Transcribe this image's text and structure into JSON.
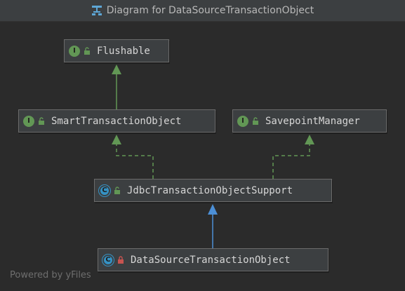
{
  "window": {
    "title": "Diagram for DataSourceTransactionObject",
    "title_icon": "diagram-icon"
  },
  "nodes": {
    "flushable": {
      "label": "Flushable",
      "kind": "I",
      "kind_icon": "interface-icon",
      "visibility_icon": "unlock-icon"
    },
    "smart_tx": {
      "label": "SmartTransactionObject",
      "kind": "I",
      "kind_icon": "interface-icon",
      "visibility_icon": "unlock-icon"
    },
    "savepoint": {
      "label": "SavepointManager",
      "kind": "I",
      "kind_icon": "interface-icon",
      "visibility_icon": "unlock-icon"
    },
    "jdbc_support": {
      "label": "JdbcTransactionObjectSupport",
      "kind": "C",
      "kind_icon": "abstract-class-icon",
      "visibility_icon": "unlock-icon"
    },
    "datasource_tx": {
      "label": "DataSourceTransactionObject",
      "kind": "C",
      "kind_icon": "class-icon",
      "visibility_icon": "lock-icon"
    }
  },
  "edges": [
    {
      "from": "smart_tx",
      "to": "flushable",
      "type": "extends-interface",
      "color": "#629755"
    },
    {
      "from": "jdbc_support",
      "to": "smart_tx",
      "type": "implements",
      "color": "#629755"
    },
    {
      "from": "jdbc_support",
      "to": "savepoint",
      "type": "implements",
      "color": "#629755"
    },
    {
      "from": "datasource_tx",
      "to": "jdbc_support",
      "type": "extends-class",
      "color": "#4c8fd6"
    }
  ],
  "footer": {
    "text": "Powered by yFiles"
  },
  "colors": {
    "background": "#2b2b2b",
    "node_fill": "#3c3f41",
    "node_border": "#6b6b6b",
    "interface_badge": "#629755",
    "class_badge": "#3592c4",
    "extends_arrow": "#4c8fd6",
    "implements_arrow": "#629755",
    "private_lock": "#c75450"
  }
}
